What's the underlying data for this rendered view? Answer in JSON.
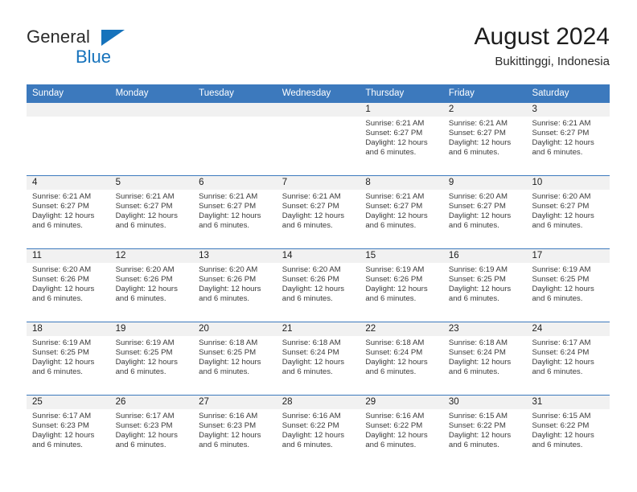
{
  "brand": {
    "name_top": "General",
    "name_bottom": "Blue",
    "accent_color": "#1673bc"
  },
  "header": {
    "title": "August 2024",
    "subtitle": "Bukittinggi, Indonesia"
  },
  "calendar": {
    "header_color": "#3c79bd",
    "daynum_band_color": "#f1f1f1",
    "weekday_headers": [
      "Sunday",
      "Monday",
      "Tuesday",
      "Wednesday",
      "Thursday",
      "Friday",
      "Saturday"
    ],
    "labels": {
      "sunrise_prefix": "Sunrise: ",
      "sunset_prefix": "Sunset: ",
      "daylight_prefix": "Daylight: "
    },
    "weeks": [
      [
        {
          "day": "",
          "empty": true
        },
        {
          "day": "",
          "empty": true
        },
        {
          "day": "",
          "empty": true
        },
        {
          "day": "",
          "empty": true
        },
        {
          "day": "1",
          "sunrise": "Sunrise: 6:21 AM",
          "sunset": "Sunset: 6:27 PM",
          "daylight": "Daylight: 12 hours and 6 minutes."
        },
        {
          "day": "2",
          "sunrise": "Sunrise: 6:21 AM",
          "sunset": "Sunset: 6:27 PM",
          "daylight": "Daylight: 12 hours and 6 minutes."
        },
        {
          "day": "3",
          "sunrise": "Sunrise: 6:21 AM",
          "sunset": "Sunset: 6:27 PM",
          "daylight": "Daylight: 12 hours and 6 minutes."
        }
      ],
      [
        {
          "day": "4",
          "sunrise": "Sunrise: 6:21 AM",
          "sunset": "Sunset: 6:27 PM",
          "daylight": "Daylight: 12 hours and 6 minutes."
        },
        {
          "day": "5",
          "sunrise": "Sunrise: 6:21 AM",
          "sunset": "Sunset: 6:27 PM",
          "daylight": "Daylight: 12 hours and 6 minutes."
        },
        {
          "day": "6",
          "sunrise": "Sunrise: 6:21 AM",
          "sunset": "Sunset: 6:27 PM",
          "daylight": "Daylight: 12 hours and 6 minutes."
        },
        {
          "day": "7",
          "sunrise": "Sunrise: 6:21 AM",
          "sunset": "Sunset: 6:27 PM",
          "daylight": "Daylight: 12 hours and 6 minutes."
        },
        {
          "day": "8",
          "sunrise": "Sunrise: 6:21 AM",
          "sunset": "Sunset: 6:27 PM",
          "daylight": "Daylight: 12 hours and 6 minutes."
        },
        {
          "day": "9",
          "sunrise": "Sunrise: 6:20 AM",
          "sunset": "Sunset: 6:27 PM",
          "daylight": "Daylight: 12 hours and 6 minutes."
        },
        {
          "day": "10",
          "sunrise": "Sunrise: 6:20 AM",
          "sunset": "Sunset: 6:27 PM",
          "daylight": "Daylight: 12 hours and 6 minutes."
        }
      ],
      [
        {
          "day": "11",
          "sunrise": "Sunrise: 6:20 AM",
          "sunset": "Sunset: 6:26 PM",
          "daylight": "Daylight: 12 hours and 6 minutes."
        },
        {
          "day": "12",
          "sunrise": "Sunrise: 6:20 AM",
          "sunset": "Sunset: 6:26 PM",
          "daylight": "Daylight: 12 hours and 6 minutes."
        },
        {
          "day": "13",
          "sunrise": "Sunrise: 6:20 AM",
          "sunset": "Sunset: 6:26 PM",
          "daylight": "Daylight: 12 hours and 6 minutes."
        },
        {
          "day": "14",
          "sunrise": "Sunrise: 6:20 AM",
          "sunset": "Sunset: 6:26 PM",
          "daylight": "Daylight: 12 hours and 6 minutes."
        },
        {
          "day": "15",
          "sunrise": "Sunrise: 6:19 AM",
          "sunset": "Sunset: 6:26 PM",
          "daylight": "Daylight: 12 hours and 6 minutes."
        },
        {
          "day": "16",
          "sunrise": "Sunrise: 6:19 AM",
          "sunset": "Sunset: 6:25 PM",
          "daylight": "Daylight: 12 hours and 6 minutes."
        },
        {
          "day": "17",
          "sunrise": "Sunrise: 6:19 AM",
          "sunset": "Sunset: 6:25 PM",
          "daylight": "Daylight: 12 hours and 6 minutes."
        }
      ],
      [
        {
          "day": "18",
          "sunrise": "Sunrise: 6:19 AM",
          "sunset": "Sunset: 6:25 PM",
          "daylight": "Daylight: 12 hours and 6 minutes."
        },
        {
          "day": "19",
          "sunrise": "Sunrise: 6:19 AM",
          "sunset": "Sunset: 6:25 PM",
          "daylight": "Daylight: 12 hours and 6 minutes."
        },
        {
          "day": "20",
          "sunrise": "Sunrise: 6:18 AM",
          "sunset": "Sunset: 6:25 PM",
          "daylight": "Daylight: 12 hours and 6 minutes."
        },
        {
          "day": "21",
          "sunrise": "Sunrise: 6:18 AM",
          "sunset": "Sunset: 6:24 PM",
          "daylight": "Daylight: 12 hours and 6 minutes."
        },
        {
          "day": "22",
          "sunrise": "Sunrise: 6:18 AM",
          "sunset": "Sunset: 6:24 PM",
          "daylight": "Daylight: 12 hours and 6 minutes."
        },
        {
          "day": "23",
          "sunrise": "Sunrise: 6:18 AM",
          "sunset": "Sunset: 6:24 PM",
          "daylight": "Daylight: 12 hours and 6 minutes."
        },
        {
          "day": "24",
          "sunrise": "Sunrise: 6:17 AM",
          "sunset": "Sunset: 6:24 PM",
          "daylight": "Daylight: 12 hours and 6 minutes."
        }
      ],
      [
        {
          "day": "25",
          "sunrise": "Sunrise: 6:17 AM",
          "sunset": "Sunset: 6:23 PM",
          "daylight": "Daylight: 12 hours and 6 minutes."
        },
        {
          "day": "26",
          "sunrise": "Sunrise: 6:17 AM",
          "sunset": "Sunset: 6:23 PM",
          "daylight": "Daylight: 12 hours and 6 minutes."
        },
        {
          "day": "27",
          "sunrise": "Sunrise: 6:16 AM",
          "sunset": "Sunset: 6:23 PM",
          "daylight": "Daylight: 12 hours and 6 minutes."
        },
        {
          "day": "28",
          "sunrise": "Sunrise: 6:16 AM",
          "sunset": "Sunset: 6:22 PM",
          "daylight": "Daylight: 12 hours and 6 minutes."
        },
        {
          "day": "29",
          "sunrise": "Sunrise: 6:16 AM",
          "sunset": "Sunset: 6:22 PM",
          "daylight": "Daylight: 12 hours and 6 minutes."
        },
        {
          "day": "30",
          "sunrise": "Sunrise: 6:15 AM",
          "sunset": "Sunset: 6:22 PM",
          "daylight": "Daylight: 12 hours and 6 minutes."
        },
        {
          "day": "31",
          "sunrise": "Sunrise: 6:15 AM",
          "sunset": "Sunset: 6:22 PM",
          "daylight": "Daylight: 12 hours and 6 minutes."
        }
      ]
    ]
  }
}
